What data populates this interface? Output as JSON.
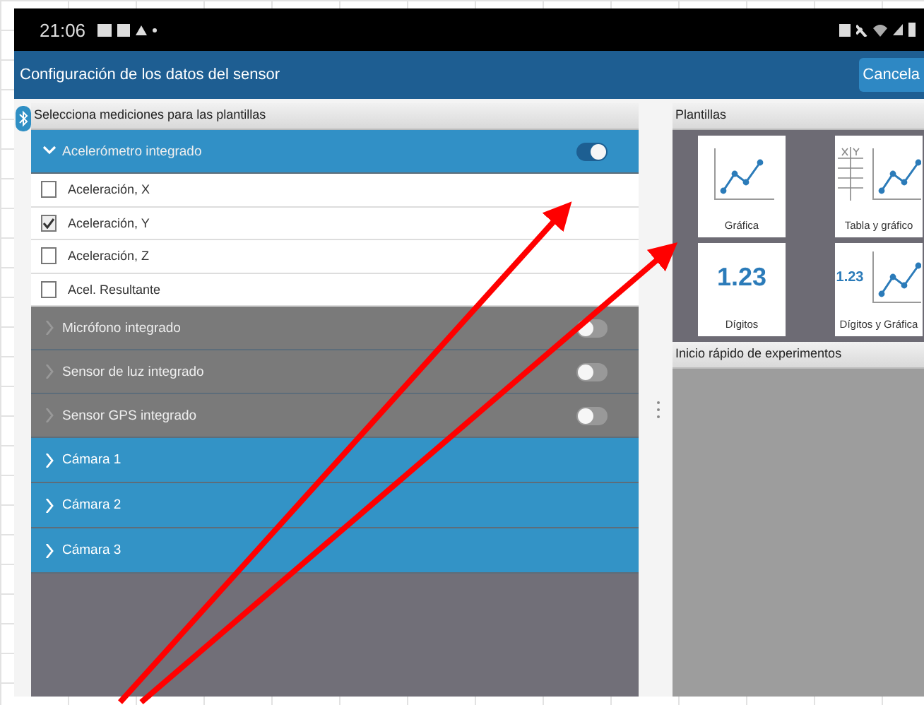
{
  "status_bar": {
    "time": "21:06"
  },
  "title_bar": {
    "title": "Configuración de los datos del sensor",
    "cancel_button": "Cancela"
  },
  "measurements": {
    "header": "Selecciona mediciones para las plantillas",
    "sensors": [
      {
        "kind": "sensor",
        "label": "Acelerómetro integrado",
        "expanded": true,
        "on": true,
        "children": [
          {
            "label": "Aceleración, X",
            "checked": false
          },
          {
            "label": "Aceleración, Y",
            "checked": true
          },
          {
            "label": "Aceleración, Z",
            "checked": false
          },
          {
            "label": "Acel. Resultante",
            "checked": false
          }
        ]
      },
      {
        "kind": "sensor",
        "label": "Micrófono integrado",
        "expanded": false,
        "on": false
      },
      {
        "kind": "sensor",
        "label": "Sensor de luz integrado",
        "expanded": false,
        "on": false
      },
      {
        "kind": "sensor",
        "label": "Sensor GPS integrado",
        "expanded": false,
        "on": false
      },
      {
        "kind": "camera",
        "label": "Cámara 1",
        "expanded": false
      },
      {
        "kind": "camera",
        "label": "Cámara 2",
        "expanded": false
      },
      {
        "kind": "camera",
        "label": "Cámara 3",
        "expanded": false
      }
    ]
  },
  "templates": {
    "header": "Plantillas",
    "tiles": [
      {
        "kind": "graph",
        "label": "Gráfica"
      },
      {
        "kind": "table_graph",
        "label": "Tabla y gráfico"
      },
      {
        "kind": "digits",
        "label": "Dígitos",
        "value": "1.23"
      },
      {
        "kind": "digits_graph",
        "label": "Dígitos y Gráfica",
        "value": "1.23"
      }
    ]
  },
  "quick_start": {
    "header": "Inicio rápido de experimentos"
  }
}
